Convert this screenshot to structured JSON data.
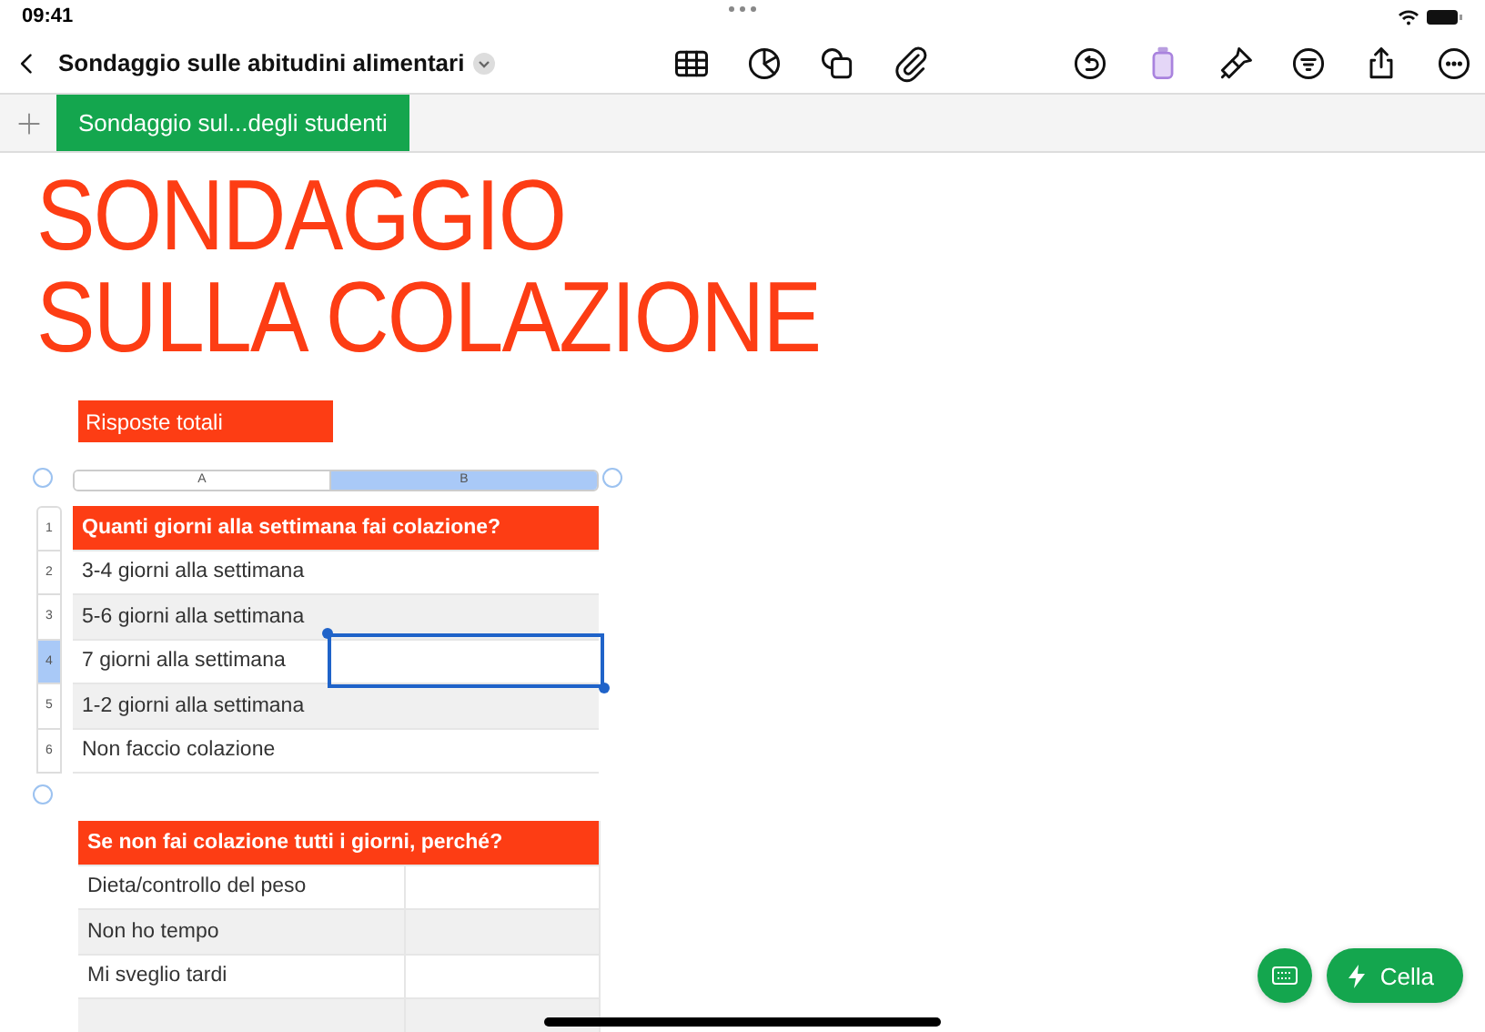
{
  "status_bar": {
    "time": "09:41"
  },
  "toolbar": {
    "title": "Sondaggio sulle abitudini alimentari"
  },
  "sheet_tabs": [
    {
      "label": "Sondaggio sul...degli studenti",
      "selected": true
    }
  ],
  "document": {
    "title_lines": [
      "SONDAGGIO",
      "SULLA COLAZIONE"
    ],
    "label": "Risposte totali",
    "table_1": {
      "columns": [
        {
          "label": "A",
          "selected": false
        },
        {
          "label": "B",
          "selected": true
        }
      ],
      "rows": [
        {
          "number": "1",
          "kind": "header",
          "text": "Quanti giorni alla settimana fai colazione?",
          "selected": false
        },
        {
          "number": "2",
          "kind": "body",
          "text": "3-4 giorni alla settimana",
          "selected": false
        },
        {
          "number": "3",
          "kind": "body",
          "text": "5-6 giorni alla settimana",
          "selected": false
        },
        {
          "number": "4",
          "kind": "body",
          "text": "7 giorni alla settimana",
          "selected": true
        },
        {
          "number": "5",
          "kind": "body",
          "text": "1-2 giorni alla settimana",
          "selected": false
        },
        {
          "number": "6",
          "kind": "body",
          "text": "Non faccio colazione",
          "selected": false
        }
      ]
    },
    "table_2": {
      "rows": [
        {
          "kind": "header",
          "text": "Se non fai colazione tutti i giorni, perché?"
        },
        {
          "kind": "body",
          "text": "Dieta/controllo del peso"
        },
        {
          "kind": "body",
          "text": "Non ho tempo"
        },
        {
          "kind": "body",
          "text": "Mi sveglio tardi"
        }
      ]
    }
  },
  "floating_buttons": {
    "cell_button": "Cella"
  }
}
